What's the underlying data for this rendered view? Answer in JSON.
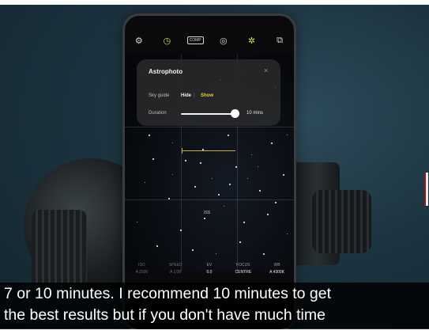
{
  "camera_app": {
    "top_icons": [
      {
        "name": "settings-icon",
        "glyph": "⚙",
        "active": false
      },
      {
        "name": "timer-icon",
        "glyph": "◷",
        "active": true
      },
      {
        "name": "compression-badge",
        "label": "COMP",
        "active": false
      },
      {
        "name": "focus-icon",
        "glyph": "◎",
        "active": false
      },
      {
        "name": "effects-icon",
        "glyph": "✲",
        "active": true
      },
      {
        "name": "layers-icon",
        "glyph": "⧉",
        "active": false
      }
    ],
    "panel": {
      "title": "Astrophoto",
      "close_glyph": "×",
      "sky_guide_label": "Sky guide",
      "sky_guide_hide": "Hide",
      "sky_guide_sep": "|",
      "sky_guide_show": "Show",
      "duration_label": "Duration",
      "duration_value": "10 mins",
      "duration_fraction": 1.0
    },
    "sky_label": "ISS",
    "settings": [
      {
        "name": "ISO",
        "value": "A 2500",
        "dim": true
      },
      {
        "name": "SPEED",
        "value": "A 1/30",
        "dim": true
      },
      {
        "name": "EV",
        "value": "0.0",
        "dim": false
      },
      {
        "name": "FOCUS",
        "value": "CENTRE",
        "dim": false
      },
      {
        "name": "WB",
        "value": "A 4300K",
        "dim": false
      }
    ]
  },
  "subtitles": {
    "line1": "7 or 10 minutes. I recommend 10 minutes to get",
    "line2": "the best results but if you don't have much time"
  },
  "colors": {
    "accent_yellow": "#e9cc3c",
    "timer_active": "#d8e23a",
    "background": "#1c3440"
  }
}
